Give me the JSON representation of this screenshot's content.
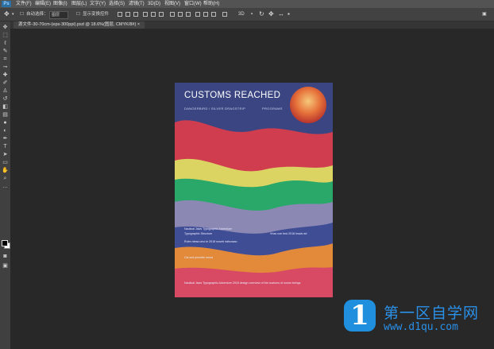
{
  "menubar": {
    "logo": "Ps",
    "items": [
      "文件(F)",
      "编辑(E)",
      "图像(I)",
      "图层(L)",
      "文字(Y)",
      "选择(S)",
      "滤镜(T)",
      "3D(D)",
      "视图(V)",
      "窗口(W)",
      "帮助(H)"
    ]
  },
  "options": {
    "auto_select_label": "自动选择：",
    "auto_select_value": "图层",
    "show_transform_label": "显示变换控件"
  },
  "document": {
    "tab_title": "源文件-30-70cm-(eps-300ppi).psd @ 18.6%(图层, CMYK/8#) ×"
  },
  "poster": {
    "title": "CUSTOMS REACHED",
    "subtitle_left": "DANGERBIRD / SILVER DRAGSTRIP",
    "subtitle_right": "PROGRAMS",
    "text_blocks": [
      "Nautical Jaws Typographic Adventure",
      "Typographic Structure",
      "Rutm ntesa umo le 2018 noseb nahcosao",
      "Cla sed pimmtte nmod",
      "Vnas noe bnd 2018 lnsaiv ad",
      "Nautical Jaws Typographic Adventure 2018 design overview of the customs of ocean beings"
    ],
    "colors": {
      "navy": "#3a4582",
      "red": "#cf3d4f",
      "yellow": "#dcd462",
      "green": "#2aa86a",
      "lavender": "#8c88b4",
      "blue": "#3f4d95",
      "orange": "#e28a3a",
      "pink": "#d84a63"
    }
  },
  "watermark": {
    "logo_char": "1",
    "brand": "第一区自学网",
    "url": "www.d1qu.com"
  },
  "tools": [
    "move-tool",
    "marquee-tool",
    "lasso-tool",
    "quick-select-tool",
    "crop-tool",
    "eyedropper-tool",
    "healing-tool",
    "brush-tool",
    "stamp-tool",
    "history-brush-tool",
    "eraser-tool",
    "gradient-tool",
    "blur-tool",
    "dodge-tool",
    "pen-tool",
    "type-tool",
    "path-select-tool",
    "shape-tool",
    "hand-tool",
    "zoom-tool",
    "more-tool"
  ]
}
